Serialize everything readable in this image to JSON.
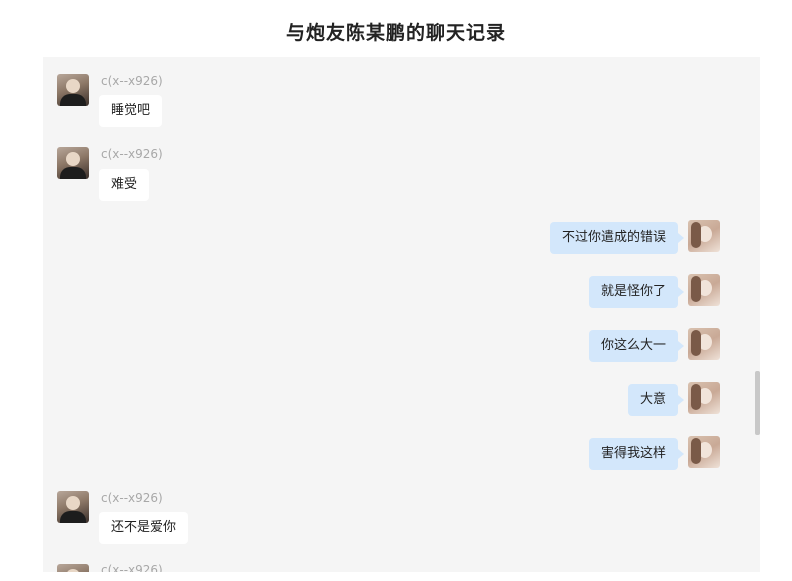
{
  "title": "与炮友陈某鹏的聊天记录",
  "messages": [
    {
      "side": "left",
      "sender": "c(x--x926)",
      "text": "睡觉吧"
    },
    {
      "side": "left",
      "sender": "c(x--x926)",
      "text": "难受"
    },
    {
      "side": "right",
      "text": "不过你遣成的错误"
    },
    {
      "side": "right",
      "text": "就是怪你了"
    },
    {
      "side": "right",
      "text": "你这么大一"
    },
    {
      "side": "right",
      "text": "大意"
    },
    {
      "side": "right",
      "text": "害得我这样"
    },
    {
      "side": "left",
      "sender": "c(x--x926)",
      "text": "还不是爱你"
    },
    {
      "side": "left",
      "sender": "c(x--x926)",
      "text": ""
    }
  ],
  "colors": {
    "panel_bg": "#f5f5f5",
    "self_bubble": "#d3e7fb",
    "other_bubble": "#ffffff",
    "sender_name": "#a8a8a8"
  },
  "icons": {
    "other_avatar": "avatar-photo",
    "self_avatar": "avatar-photo"
  }
}
